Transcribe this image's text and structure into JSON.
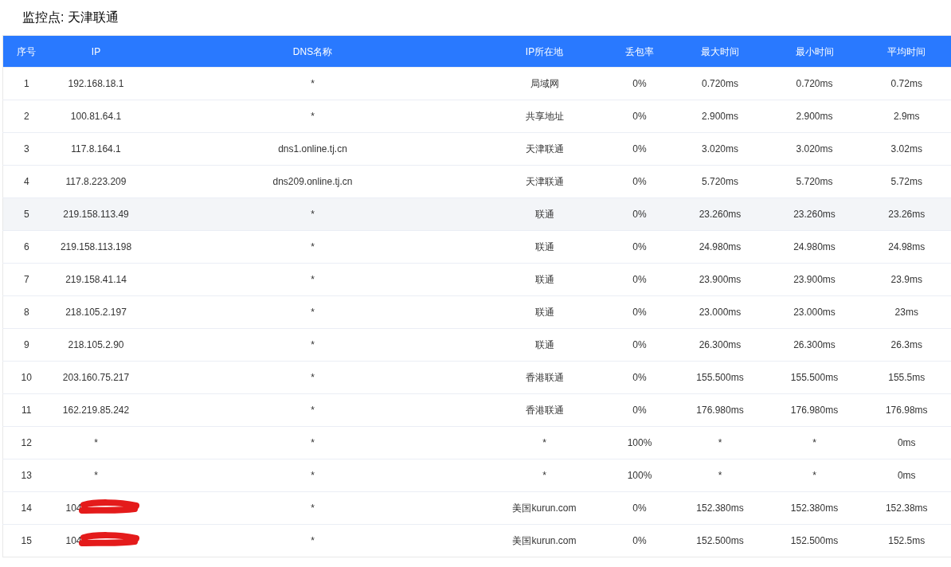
{
  "title": "监控点: 天津联通",
  "table": {
    "columns": [
      "序号",
      "IP",
      "DNS名称",
      "IP所在地",
      "丢包率",
      "最大时间",
      "最小时间",
      "平均时间"
    ],
    "rows": [
      {
        "cells": [
          "1",
          "192.168.18.1",
          "*",
          "局域网",
          "0%",
          "0.720ms",
          "0.720ms",
          "0.72ms"
        ],
        "selected": false,
        "redacted": false
      },
      {
        "cells": [
          "2",
          "100.81.64.1",
          "*",
          "共享地址",
          "0%",
          "2.900ms",
          "2.900ms",
          "2.9ms"
        ],
        "selected": false,
        "redacted": false
      },
      {
        "cells": [
          "3",
          "117.8.164.1",
          "dns1.online.tj.cn",
          "天津联通",
          "0%",
          "3.020ms",
          "3.020ms",
          "3.02ms"
        ],
        "selected": false,
        "redacted": false
      },
      {
        "cells": [
          "4",
          "117.8.223.209",
          "dns209.online.tj.cn",
          "天津联通",
          "0%",
          "5.720ms",
          "5.720ms",
          "5.72ms"
        ],
        "selected": false,
        "redacted": false
      },
      {
        "cells": [
          "5",
          "219.158.113.49",
          "*",
          "联通",
          "0%",
          "23.260ms",
          "23.260ms",
          "23.26ms"
        ],
        "selected": true,
        "redacted": false
      },
      {
        "cells": [
          "6",
          "219.158.113.198",
          "*",
          "联通",
          "0%",
          "24.980ms",
          "24.980ms",
          "24.98ms"
        ],
        "selected": false,
        "redacted": false
      },
      {
        "cells": [
          "7",
          "219.158.41.14",
          "*",
          "联通",
          "0%",
          "23.900ms",
          "23.900ms",
          "23.9ms"
        ],
        "selected": false,
        "redacted": false
      },
      {
        "cells": [
          "8",
          "218.105.2.197",
          "*",
          "联通",
          "0%",
          "23.000ms",
          "23.000ms",
          "23ms"
        ],
        "selected": false,
        "redacted": false
      },
      {
        "cells": [
          "9",
          "218.105.2.90",
          "*",
          "联通",
          "0%",
          "26.300ms",
          "26.300ms",
          "26.3ms"
        ],
        "selected": false,
        "redacted": false
      },
      {
        "cells": [
          "10",
          "203.160.75.217",
          "*",
          "香港联通",
          "0%",
          "155.500ms",
          "155.500ms",
          "155.5ms"
        ],
        "selected": false,
        "redacted": false
      },
      {
        "cells": [
          "11",
          "162.219.85.242",
          "*",
          "香港联通",
          "0%",
          "176.980ms",
          "176.980ms",
          "176.98ms"
        ],
        "selected": false,
        "redacted": false
      },
      {
        "cells": [
          "12",
          "*",
          "*",
          "*",
          "100%",
          "*",
          "*",
          "0ms"
        ],
        "selected": false,
        "redacted": false
      },
      {
        "cells": [
          "13",
          "*",
          "*",
          "*",
          "100%",
          "*",
          "*",
          "0ms"
        ],
        "selected": false,
        "redacted": false
      },
      {
        "cells": [
          "14",
          "104",
          "*",
          "美国kurun.com",
          "0%",
          "152.380ms",
          "152.380ms",
          "152.38ms"
        ],
        "selected": false,
        "redacted": true
      },
      {
        "cells": [
          "15",
          "104",
          "*",
          "美国kurun.com",
          "0%",
          "152.500ms",
          "152.500ms",
          "152.5ms"
        ],
        "selected": false,
        "redacted": true
      }
    ]
  }
}
